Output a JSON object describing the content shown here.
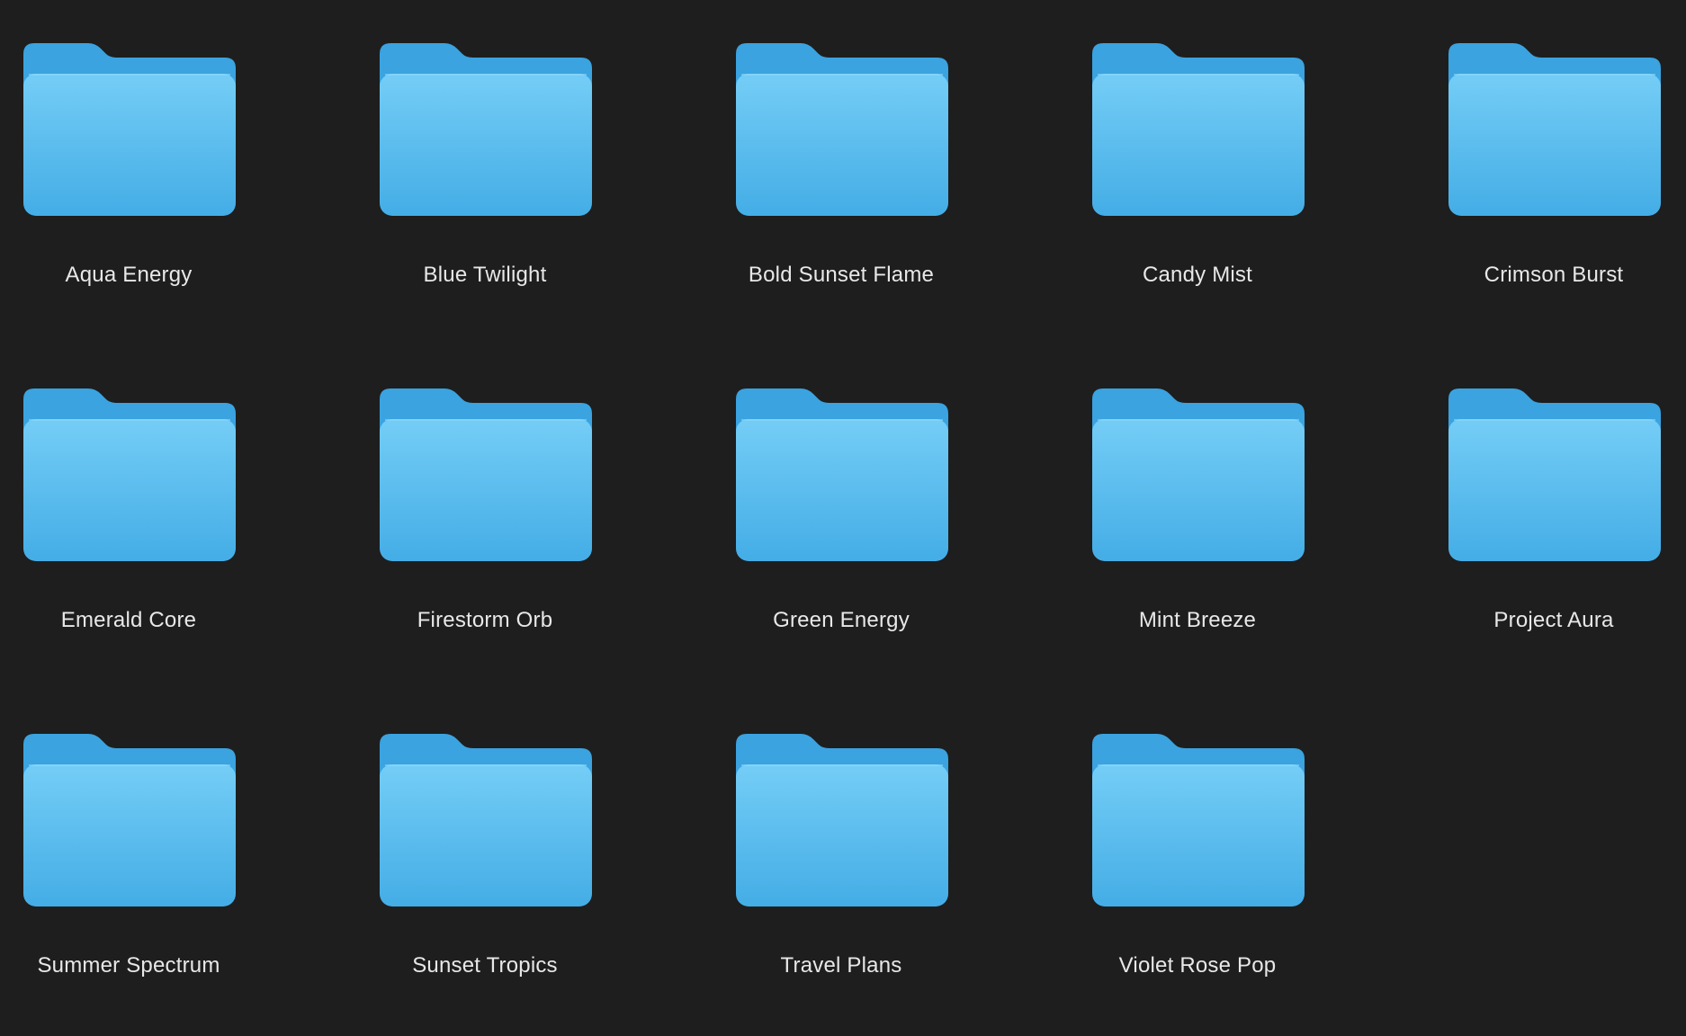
{
  "colors": {
    "background": "#1e1e1e",
    "folder_back": "#3aa3e0",
    "folder_front_top": "#74cdf6",
    "folder_front_bottom": "#44ade6",
    "label_text": "#e8e8e8"
  },
  "folders": [
    {
      "name": "Aqua Energy",
      "icon": "folder-icon"
    },
    {
      "name": "Blue Twilight",
      "icon": "folder-icon"
    },
    {
      "name": "Bold Sunset Flame",
      "icon": "folder-icon"
    },
    {
      "name": "Candy Mist",
      "icon": "folder-icon"
    },
    {
      "name": "Crimson Burst",
      "icon": "folder-icon"
    },
    {
      "name": "Emerald Core",
      "icon": "folder-icon"
    },
    {
      "name": "Firestorm Orb",
      "icon": "folder-icon"
    },
    {
      "name": "Green Energy",
      "icon": "folder-icon"
    },
    {
      "name": "Mint Breeze",
      "icon": "folder-icon"
    },
    {
      "name": "Project Aura",
      "icon": "folder-icon"
    },
    {
      "name": "Summer Spectrum",
      "icon": "folder-icon"
    },
    {
      "name": "Sunset Tropics",
      "icon": "folder-icon"
    },
    {
      "name": "Travel Plans",
      "icon": "folder-icon"
    },
    {
      "name": "Violet Rose Pop",
      "icon": "folder-icon"
    }
  ]
}
